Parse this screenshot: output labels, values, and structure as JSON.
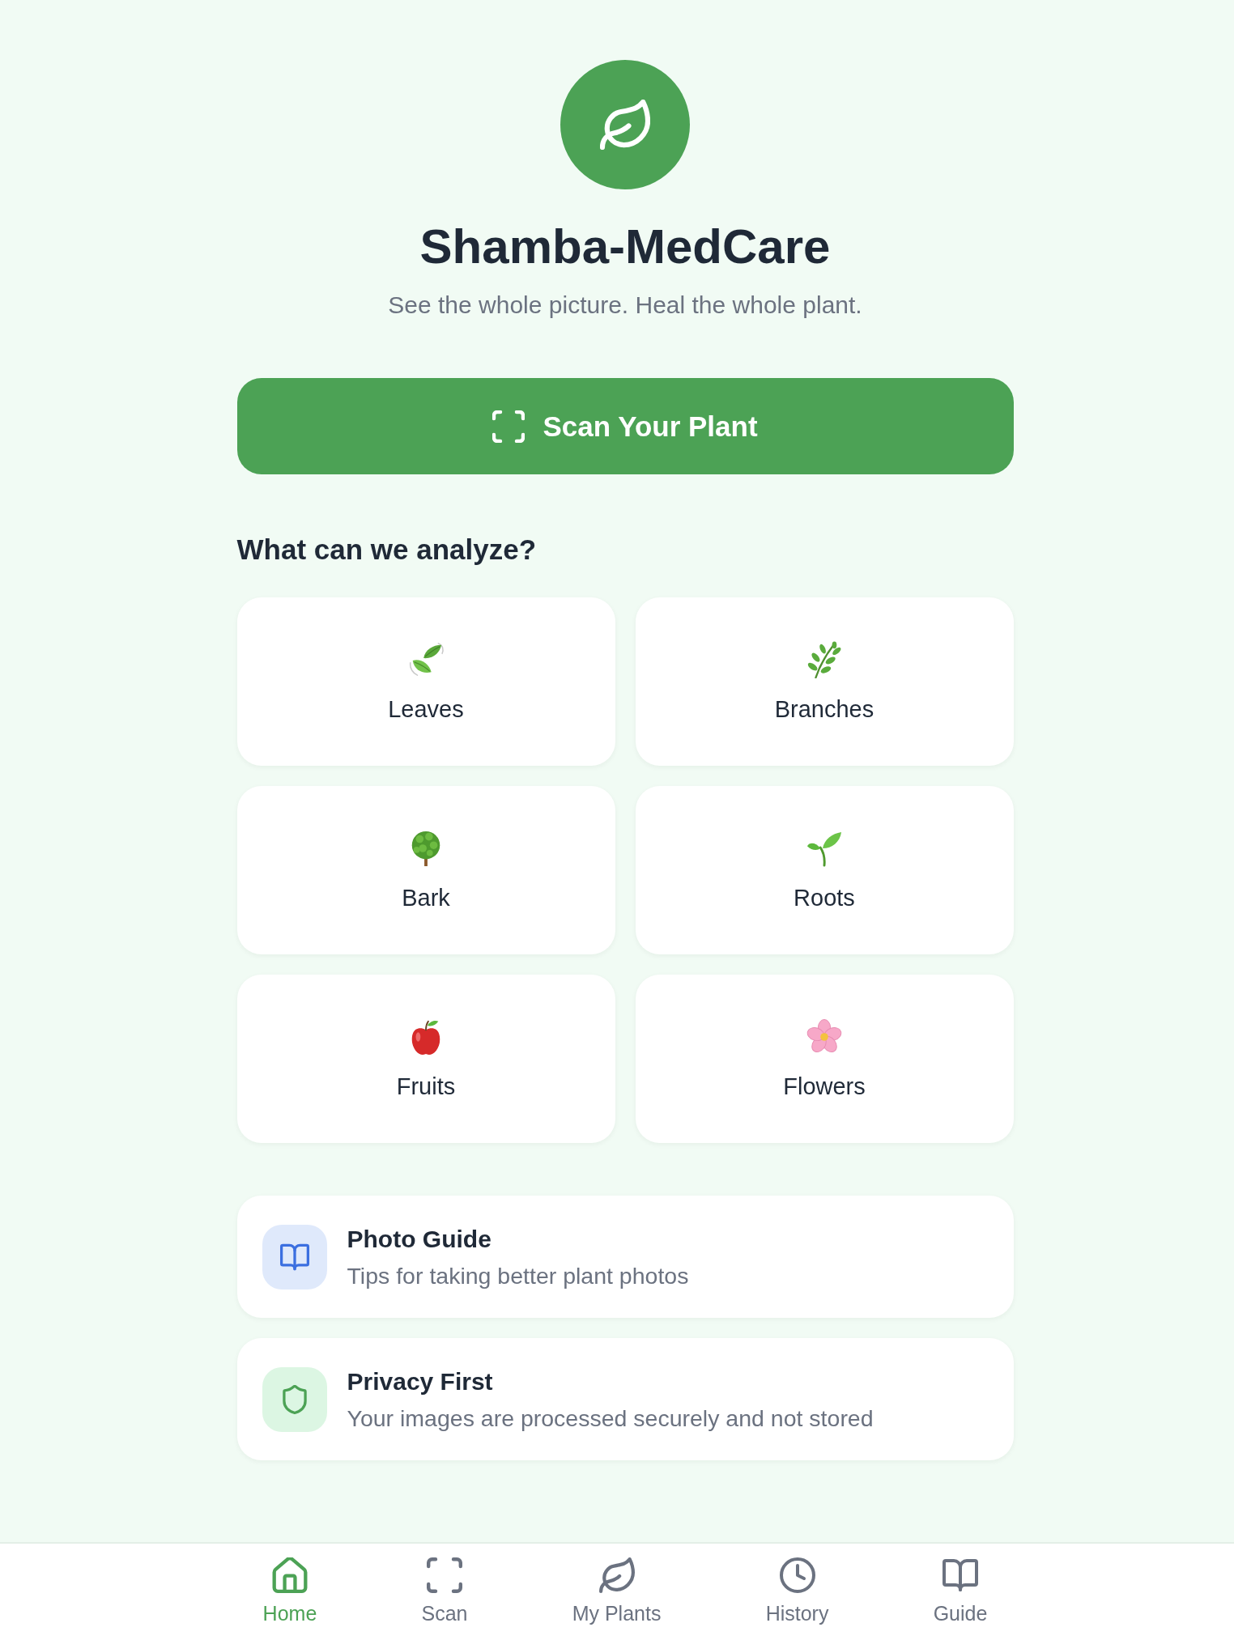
{
  "app": {
    "title": "Shamba-MedCare",
    "tagline": "See the whole picture. Heal the whole plant."
  },
  "scan_button": {
    "label": "Scan Your Plant"
  },
  "analyze_section": {
    "heading": "What can we analyze?",
    "items": [
      {
        "label": "Leaves"
      },
      {
        "label": "Branches"
      },
      {
        "label": "Bark"
      },
      {
        "label": "Roots"
      },
      {
        "label": "Fruits"
      },
      {
        "label": "Flowers"
      }
    ]
  },
  "info_cards": [
    {
      "kind": "guide",
      "title": "Photo Guide",
      "description": "Tips for taking better plant photos"
    },
    {
      "kind": "privacy",
      "title": "Privacy First",
      "description": "Your images are processed securely and not stored"
    }
  ],
  "bottom_nav": [
    {
      "label": "Home",
      "selected": true
    },
    {
      "label": "Scan",
      "selected": false
    },
    {
      "label": "My Plants",
      "selected": false
    },
    {
      "label": "History",
      "selected": false
    },
    {
      "label": "Guide",
      "selected": false
    }
  ]
}
